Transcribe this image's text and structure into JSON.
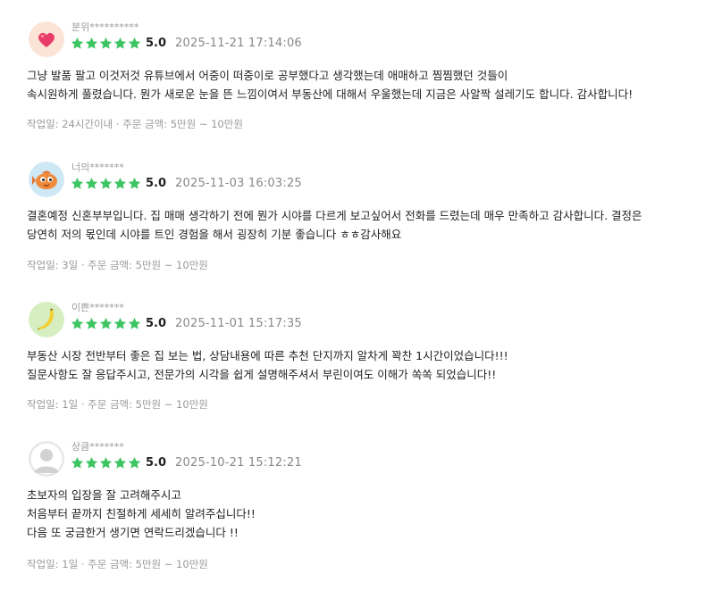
{
  "colors": {
    "star": "#3ec563",
    "meta": "#9a9a9a",
    "date": "#888888"
  },
  "reviews": [
    {
      "avatar_icon": "heart-avatar-icon",
      "nickname": "분위**********",
      "rating": 5,
      "score": "5.0",
      "date": "2025-11-21 17:14:06",
      "lines": [
        "그냥 발품 팔고 이것저것 유튜브에서 어중이 떠중이로 공부했다고 생각했는데 애매하고 찜찜했던 것들이",
        "속시원하게 풀렸습니다. 뭔가 새로운 눈을 뜬 느낌이여서 부동산에 대해서 우울했는데 지금은 사알짝 설레기도 합니다. 감사합니다!"
      ],
      "meta": "작업일: 24시간이내 · 주문 금액: 5만원 ~ 10만원"
    },
    {
      "avatar_icon": "fish-avatar-icon",
      "nickname": "너의*******",
      "rating": 5,
      "score": "5.0",
      "date": "2025-11-03 16:03:25",
      "lines": [
        "결혼예정 신혼부부입니다. 집 매매 생각하기 전에 뭔가 시야를 다르게 보고싶어서 전화를 드렸는데 매우 만족하고 감사합니다. 결정은",
        "당연히 저의 몫인데 시야를 트인 경험을 해서 굉장히 기분 좋습니다 ㅎㅎ감사해요"
      ],
      "meta": "작업일: 3일 · 주문 금액: 5만원 ~ 10만원"
    },
    {
      "avatar_icon": "banana-avatar-icon",
      "nickname": "이쁜*******",
      "rating": 5,
      "score": "5.0",
      "date": "2025-11-01 15:17:35",
      "lines": [
        "부동산 시장 전반부터 좋은 집 보는 법, 상담내용에 따른  추천 단지까지 알차게 꽉찬 1시간이었습니다!!!",
        "질문사항도 잘 응답주시고, 전문가의 시각을 쉽게 설명해주셔서 부린이여도 이해가 쏙쏙 되었습니다!!"
      ],
      "meta": "작업일: 1일 · 주문 금액: 5만원 ~ 10만원"
    },
    {
      "avatar_icon": "default-user-avatar-icon",
      "nickname": "상큼*******",
      "rating": 5,
      "score": "5.0",
      "date": "2025-10-21 15:12:21",
      "lines": [
        "초보자의 입장을 잘 고려해주시고",
        "처음부터 끝까지 친절하게 세세히 알려주십니다!!",
        "다음 또 궁금한거 생기면 연락드리겠습니다 !!"
      ],
      "meta": "작업일: 1일 · 주문 금액: 5만원 ~ 10만원"
    }
  ]
}
